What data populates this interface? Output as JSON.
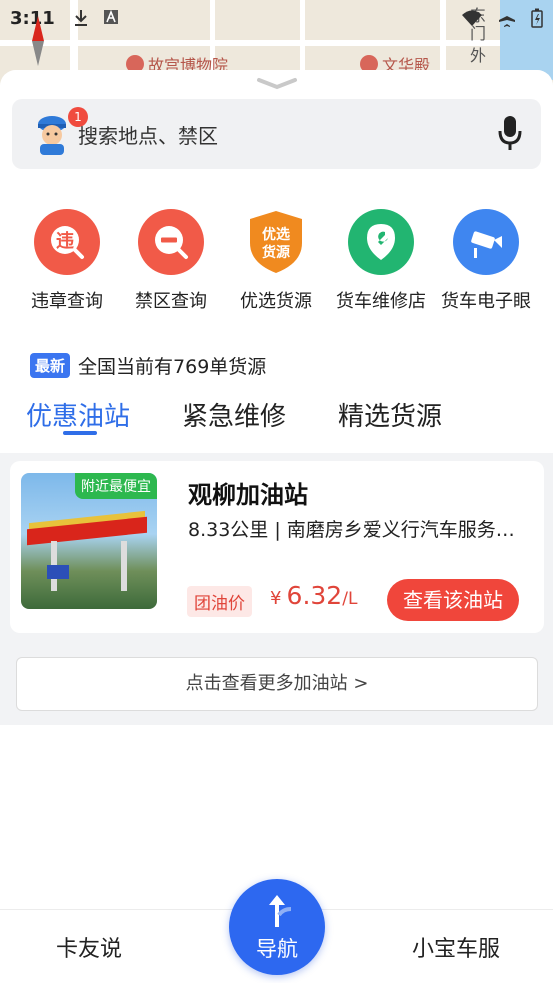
{
  "status_bar": {
    "time": "3:11"
  },
  "map": {
    "poi_1": "故宫博物院",
    "poi_2": "文华殿",
    "label_1": "东",
    "label_2": "门",
    "label_3": "外"
  },
  "search": {
    "placeholder": "搜索地点、禁区",
    "avatar_badge": "1"
  },
  "quick_actions": [
    {
      "label": "违章查询",
      "icon": "violation-icon",
      "glyph": "违",
      "color": "#f15a48"
    },
    {
      "label": "禁区查询",
      "icon": "restricted-zone-icon",
      "glyph": "",
      "color": "#f15a48"
    },
    {
      "label": "优选货源",
      "icon": "cargo-shield-icon",
      "glyph": "优选\n货源",
      "color": "#f08a1f"
    },
    {
      "label": "货车维修店",
      "icon": "repair-wrench-icon",
      "glyph": "",
      "color": "#22b571"
    },
    {
      "label": "货车电子眼",
      "icon": "camera-icon",
      "glyph": "",
      "color": "#3f86f0"
    }
  ],
  "news": {
    "tag": "最新",
    "text": "全国当前有769单货源"
  },
  "tabs": [
    {
      "label": "优惠油站",
      "active": true
    },
    {
      "label": "紧急维修",
      "active": false
    },
    {
      "label": "精选货源",
      "active": false
    }
  ],
  "station": {
    "badge": "附近最便宜",
    "name": "观柳加油站",
    "address": "8.33公里 | 南磨房乡爱义行汽车服务…",
    "price_tag": "团油价",
    "currency": "¥",
    "price": "6.32",
    "unit": "/L",
    "button": "查看该油站"
  },
  "more_link": "点击查看更多加油站 >",
  "bottom_nav": {
    "left": "卡友说",
    "center": "导航",
    "right": "小宝车服"
  },
  "colors": {
    "accent_blue": "#2f6ee8",
    "price_red": "#e0453a",
    "nav_blue": "#2d68f0"
  }
}
